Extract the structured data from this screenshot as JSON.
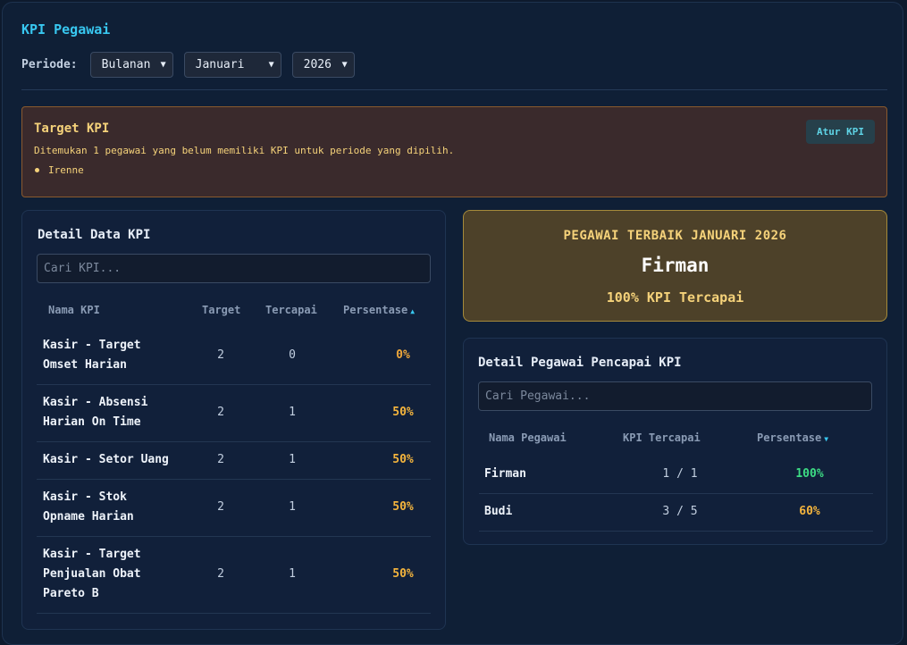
{
  "page_title": "KPI Pegawai",
  "filters": {
    "label": "Periode:",
    "period_type": "Bulanan",
    "month": "Januari",
    "year": "2026"
  },
  "warning": {
    "title": "Target KPI",
    "message": "Ditemukan 1 pegawai yang belum memiliki KPI untuk periode yang dipilih.",
    "employees": [
      "Irenne"
    ],
    "button_label": "Atur KPI"
  },
  "kpi_detail": {
    "title": "Detail Data KPI",
    "search_placeholder": "Cari KPI...",
    "columns": [
      "Nama KPI",
      "Target",
      "Tercapai",
      "Persentase"
    ],
    "rows": [
      {
        "name_lines": [
          "Kasir - Target",
          "Omset Harian"
        ],
        "target": "2",
        "achieved": "0",
        "percent": "0%",
        "color": "#f0a83a"
      },
      {
        "name_lines": [
          "Kasir - Absensi",
          "Harian On Time"
        ],
        "target": "2",
        "achieved": "1",
        "percent": "50%",
        "color": "#f5b53d"
      },
      {
        "name_lines": [
          "Kasir - Setor Uang"
        ],
        "target": "2",
        "achieved": "1",
        "percent": "50%",
        "color": "#f5b53d"
      },
      {
        "name_lines": [
          "Kasir - Stok",
          "Opname Harian"
        ],
        "target": "2",
        "achieved": "1",
        "percent": "50%",
        "color": "#f5b53d"
      },
      {
        "name_lines": [
          "Kasir - Target",
          "Penjualan Obat",
          "Pareto B"
        ],
        "target": "2",
        "achieved": "1",
        "percent": "50%",
        "color": "#f5b53d"
      }
    ]
  },
  "best_employee": {
    "title": "PEGAWAI TERBAIK JANUARI 2026",
    "name": "Firman",
    "subtitle": "100% KPI Tercapai"
  },
  "employee_detail": {
    "title": "Detail Pegawai Pencapai KPI",
    "search_placeholder": "Cari Pegawai...",
    "columns": [
      "Nama Pegawai",
      "KPI Tercapai",
      "Persentase"
    ],
    "rows": [
      {
        "name": "Firman",
        "achieved": "1 / 1",
        "percent": "100%",
        "color": "#3ddc84"
      },
      {
        "name": "Budi",
        "achieved": "3 / 5",
        "percent": "60%",
        "color": "#f5b53d"
      }
    ]
  },
  "icons": {
    "sort_asc": "triangle-up",
    "sort_desc": "triangle-down",
    "select_chevron": "chevron-down"
  }
}
